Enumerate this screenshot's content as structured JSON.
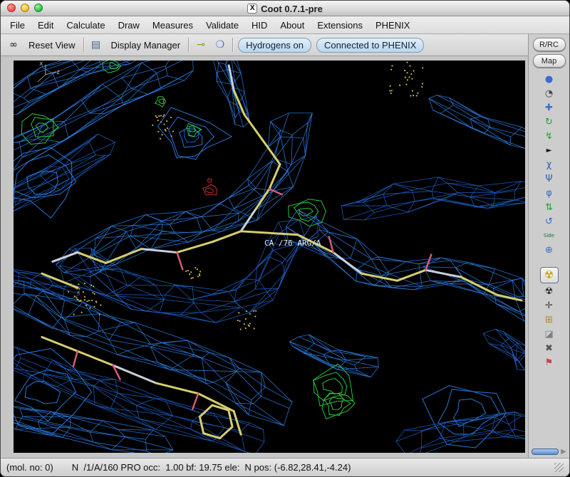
{
  "titlebar": {
    "icon": "X",
    "title": "Coot 0.7.1-pre"
  },
  "menubar": {
    "items": [
      "File",
      "Edit",
      "Calculate",
      "Draw",
      "Measures",
      "Validate",
      "HID",
      "About",
      "Extensions",
      "PHENIX"
    ]
  },
  "toolbar": {
    "reset_view": "Reset View",
    "display_manager": "Display Manager",
    "hydrogens_toggle": "Hydrogens on",
    "phenix_status": "Connected to PHENIX",
    "icons": {
      "glasses": {
        "glyph": "∞",
        "style": "color:#1a1a1a"
      },
      "display_list": {
        "glyph": "▤",
        "style": "color:#4a5a8a"
      },
      "go_to_atom": {
        "glyph": "⊸",
        "style": "color:#8f9a12"
      },
      "go_to_residue": {
        "glyph": "❍",
        "style": "color:#3a6bd0"
      }
    }
  },
  "right_toolbar": {
    "rrc": "R/RC",
    "map": "Map",
    "expand": "▶",
    "icons": [
      {
        "glyph": "●",
        "style": "color:#3a6bd0"
      },
      {
        "glyph": "◔",
        "style": "color:#444444"
      },
      {
        "glyph": "✚",
        "style": "color:#3a6bd0"
      },
      {
        "glyph": "↻",
        "style": "color:#1fa32e"
      },
      {
        "glyph": "↯",
        "style": "color:#1fa32e"
      },
      {
        "glyph": "►",
        "style": "color:#111111;font-size:10px"
      },
      {
        "glyph": "χ",
        "style": "color:#2f5fc4"
      },
      {
        "glyph": "Ψ",
        "style": "color:#2f5fc4"
      },
      {
        "glyph": "φ",
        "style": "color:#3a6bd0"
      },
      {
        "glyph": "⇅",
        "style": "color:#1fa32e"
      },
      {
        "glyph": "↺",
        "style": "color:#3a6bd0"
      },
      {
        "glyph": "Side",
        "style": "color:#0a7a3a;font-size:7px"
      },
      {
        "glyph": "⊕",
        "style": "color:#3a6bd0"
      },
      {
        "glyph": "☢",
        "style": "color:#c9a100"
      },
      {
        "glyph": "☢",
        "style": "color:#222222"
      },
      {
        "glyph": "✛",
        "style": "color:#444444"
      },
      {
        "glyph": "⊞",
        "style": "color:#b08820"
      },
      {
        "glyph": "◪",
        "style": "color:#7a8288"
      },
      {
        "glyph": "✖",
        "style": "color:#555555"
      },
      {
        "glyph": "⚑",
        "style": "color:#cc4444"
      }
    ]
  },
  "canvas": {
    "atom_label": "CA /76 ARG/A",
    "axis_labels": [
      "x",
      "z"
    ]
  },
  "statusbar": {
    "mol": "(mol. no: 0)",
    "atom": "N  /1/A/160 PRO occ:  1.00 bf: 19.75 ele:  N pos: (-6.82,28.41,-4.24)"
  },
  "colors": {
    "mesh_blue": "#2b7de0",
    "mesh_blue_dark": "#1d5fc0",
    "diff_green": "#2fcf3f",
    "diff_red": "#d03038",
    "model_yellow": "#d6cf6e",
    "model_white": "#c9d0da",
    "model_red": "#d85a78",
    "waters_yellow": "#c9b350"
  }
}
